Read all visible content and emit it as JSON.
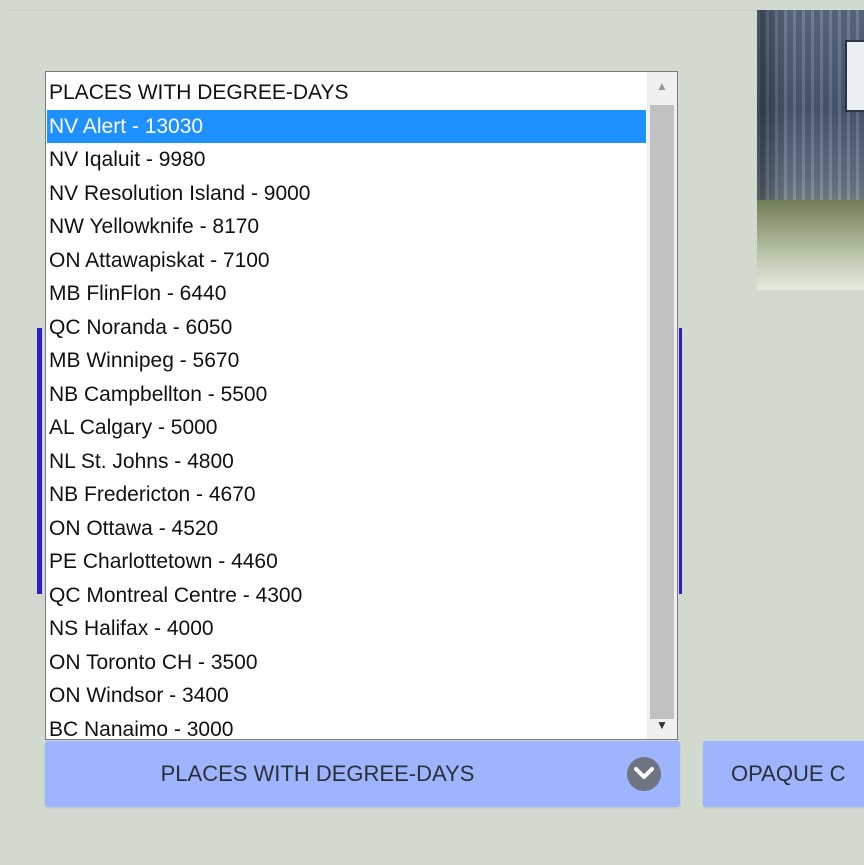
{
  "degree_days_list": {
    "items": [
      "PLACES WITH DEGREE-DAYS",
      "NV Alert - 13030",
      "NV Iqaluit - 9980",
      "NV Resolution Island - 9000",
      "NW Yellowknife - 8170",
      "ON Attawapiskat - 7100",
      "MB FlinFlon - 6440",
      "QC Noranda - 6050",
      "MB Winnipeg - 5670",
      "NB Campbellton - 5500",
      "AL Calgary - 5000",
      "NL St. Johns - 4800",
      "NB Fredericton - 4670",
      "ON Ottawa - 4520",
      "PE Charlottetown - 4460",
      "QC Montreal Centre - 4300",
      "NS Halifax - 4000",
      "ON Toronto CH - 3500",
      "ON Windsor - 3400",
      "BC Nanaimo - 3000"
    ],
    "selected_item": "NV Alert - 13030"
  },
  "select_button": {
    "label": "PLACES WITH DEGREE-DAYS",
    "icon": "chevron-down-icon"
  },
  "second_button": {
    "label": "OPAQUE C"
  },
  "photo": {
    "icon": "shipping-container-photo"
  },
  "colors": {
    "background": "#d2dad0",
    "selection": "#1e90ff",
    "button": "#9eb4ff",
    "accent_line": "#2c1bd1"
  }
}
